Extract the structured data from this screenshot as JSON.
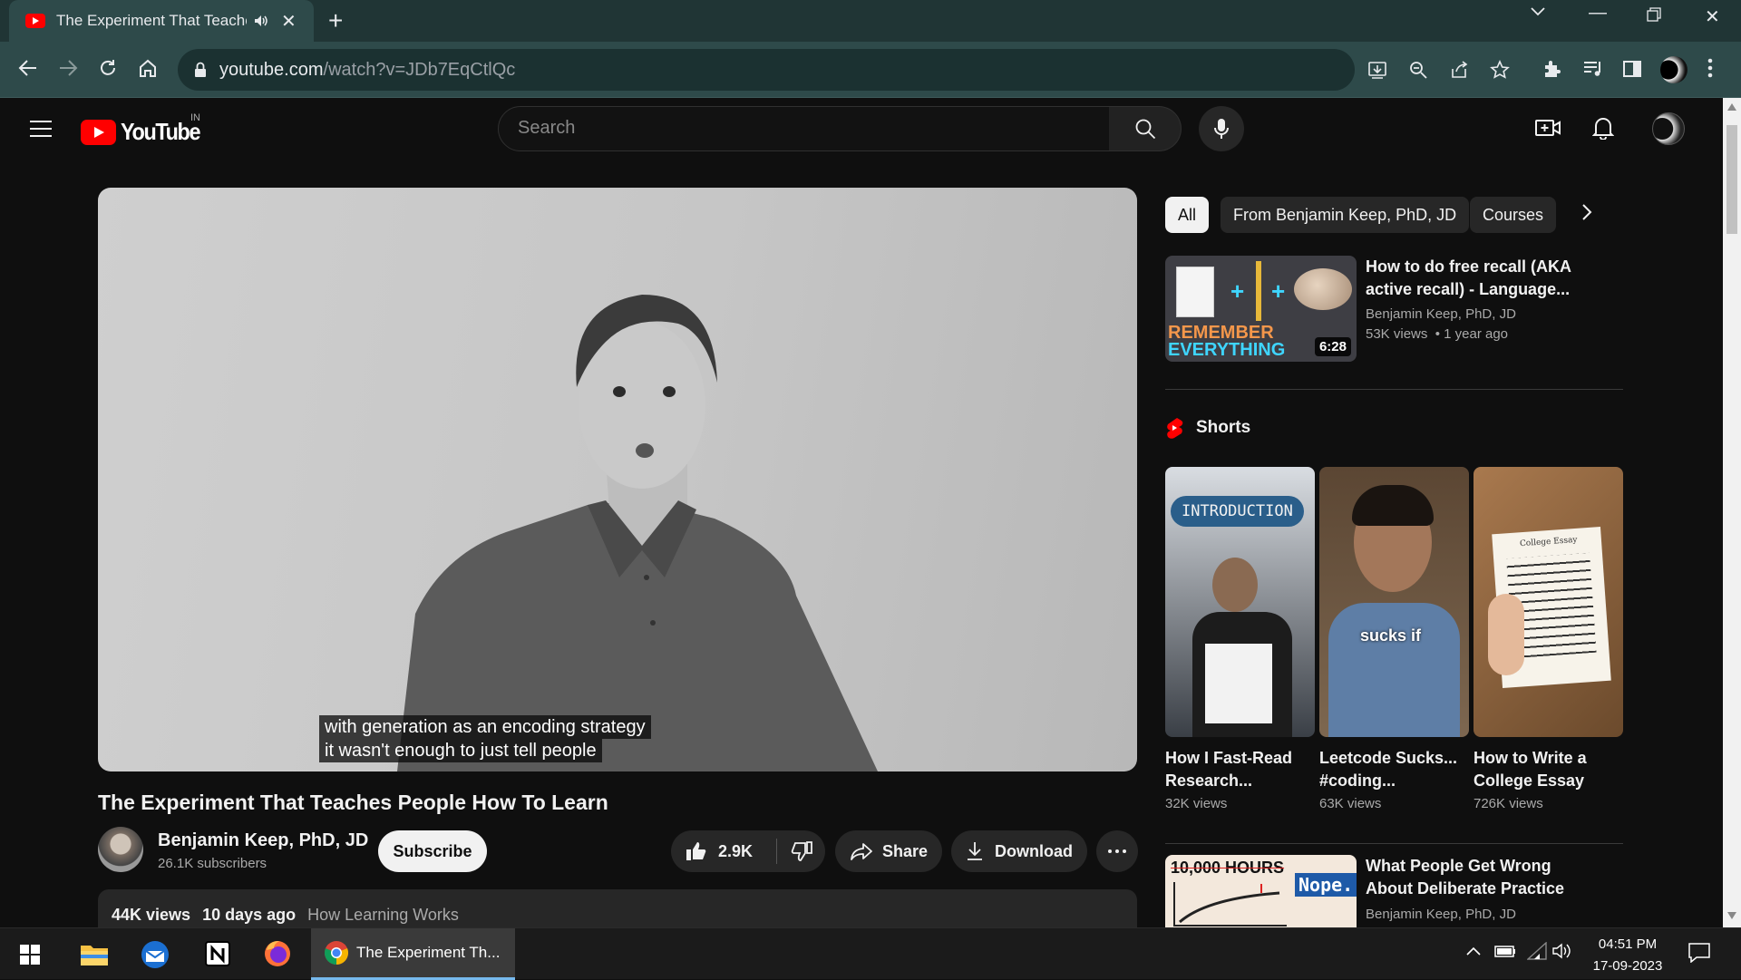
{
  "browser": {
    "tab_title": "The Experiment That Teaches",
    "url_host": "youtube.com",
    "url_path": "/watch?v=JDb7EqCtlQc"
  },
  "youtube": {
    "logo_text": "YouTube",
    "country": "IN",
    "search_placeholder": "Search"
  },
  "player": {
    "captions": [
      "with generation as an encoding strategy",
      "it wasn't enough to just tell people"
    ]
  },
  "video": {
    "title": "The Experiment That Teaches People How To Learn",
    "channel": "Benjamin Keep, PhD, JD",
    "subscribers": "26.1K subscribers",
    "subscribe_label": "Subscribe",
    "likes": "2.9K",
    "share_label": "Share",
    "download_label": "Download",
    "views": "44K views",
    "date": "10 days ago",
    "tag": "How Learning Works"
  },
  "chips": [
    "All",
    "From Benjamin Keep, PhD, JD",
    "Courses"
  ],
  "recommended": [
    {
      "title": "How to do free recall (AKA active recall) - Language...",
      "channel": "Benjamin Keep, PhD, JD",
      "views": "53K views",
      "age": "1 year ago",
      "duration": "6:28",
      "thumb_text": [
        "REMEMBER",
        "EVERYTHING"
      ]
    },
    {
      "title": "What People Get Wrong About Deliberate Practice",
      "channel": "Benjamin Keep, PhD, JD",
      "thumb_text": [
        "10,000 HOURS",
        "Nope."
      ]
    }
  ],
  "shorts_heading": "Shorts",
  "shorts": [
    {
      "title": "How I Fast-Read Research...",
      "views": "32K views",
      "overlay": "INTRODUCTION"
    },
    {
      "title": "Leetcode Sucks... #coding...",
      "views": "63K views",
      "overlay": "sucks if"
    },
    {
      "title": "How to Write a College Essay",
      "views": "726K views",
      "overlay": "College Essay"
    }
  ],
  "taskbar": {
    "active_app": "The Experiment Th...",
    "time": "04:51 PM",
    "date": "17-09-2023"
  },
  "colors": {
    "background": "#0f0f0f",
    "chrome_frame": "#203535",
    "chrome_toolbar": "#2e4a4a",
    "youtube_red": "#ff0000"
  }
}
